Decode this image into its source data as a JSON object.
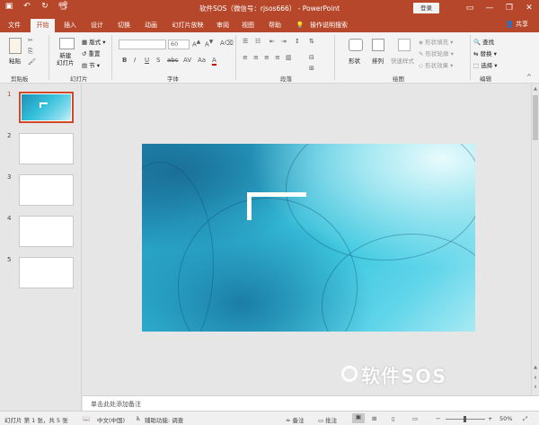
{
  "titlebar": {
    "qat": [
      "▣",
      "↶",
      "↻",
      "📽"
    ],
    "title": "软件SOS（微信号：rjsos666） - PowerPoint",
    "login": "登录",
    "controls": [
      "▭",
      "—",
      "❐",
      "✕"
    ]
  },
  "tabs": [
    "文件",
    "开始",
    "插入",
    "设计",
    "切换",
    "动画",
    "幻灯片放映",
    "审阅",
    "视图",
    "帮助",
    "操作说明搜索"
  ],
  "share": "共享",
  "ribbon": {
    "clipboard": {
      "paste": "粘贴",
      "label": "剪贴板"
    },
    "slides": {
      "new_slide": "新建\n幻灯片",
      "layout": "版式",
      "reset": "重置",
      "section": "节",
      "label": "幻灯片"
    },
    "font": {
      "name_placeholder": "",
      "size": "60",
      "label": "字体",
      "bold": "B",
      "italic": "I",
      "underline": "U",
      "strike": "S",
      "shadow": "abc",
      "spacing": "AV",
      "case": "Aa",
      "color": "A"
    },
    "paragraph": {
      "label": "段落"
    },
    "drawing": {
      "shapes": "形状",
      "arrange": "排列",
      "quick_styles": "快速样式",
      "fill": "形状填充",
      "outline": "形状轮廓",
      "effects": "形状效果",
      "label": "绘图"
    },
    "editing": {
      "find": "查找",
      "replace": "替换",
      "select": "选择",
      "label": "编辑"
    }
  },
  "thumbnails": [
    "1",
    "2",
    "3",
    "4",
    "5"
  ],
  "notes_placeholder": "单击此处添加备注",
  "watermark": "软件SOS",
  "status": {
    "slide_info": "幻灯片 第 1 张，共 5 张",
    "language": "中文(中国)",
    "accessibility": "辅助功能: 调查",
    "notes": "备注",
    "comments": "批注",
    "zoom": "50%"
  },
  "colors": {
    "accent": "#b7472a",
    "slide_selected_border": "#d24726"
  }
}
